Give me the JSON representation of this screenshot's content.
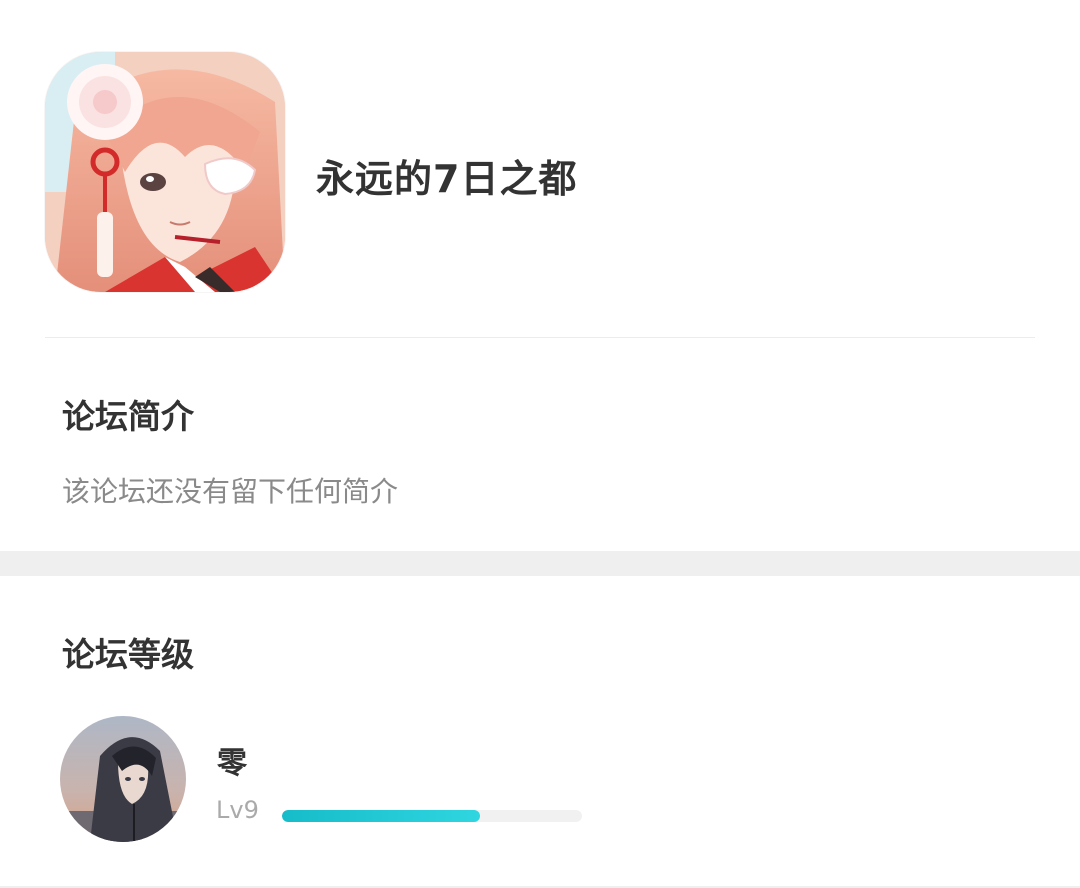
{
  "header": {
    "forum_name": "永远的7日之都",
    "icon": "forum-app-icon"
  },
  "intro": {
    "title": "论坛简介",
    "text": "该论坛还没有留下任何简介"
  },
  "level": {
    "title": "论坛等级",
    "user_name": "零",
    "level_label": "Lv9",
    "progress_fraction": 0.66,
    "progress_color": "#1ec8d3",
    "track_color": "#f1f1f1"
  }
}
